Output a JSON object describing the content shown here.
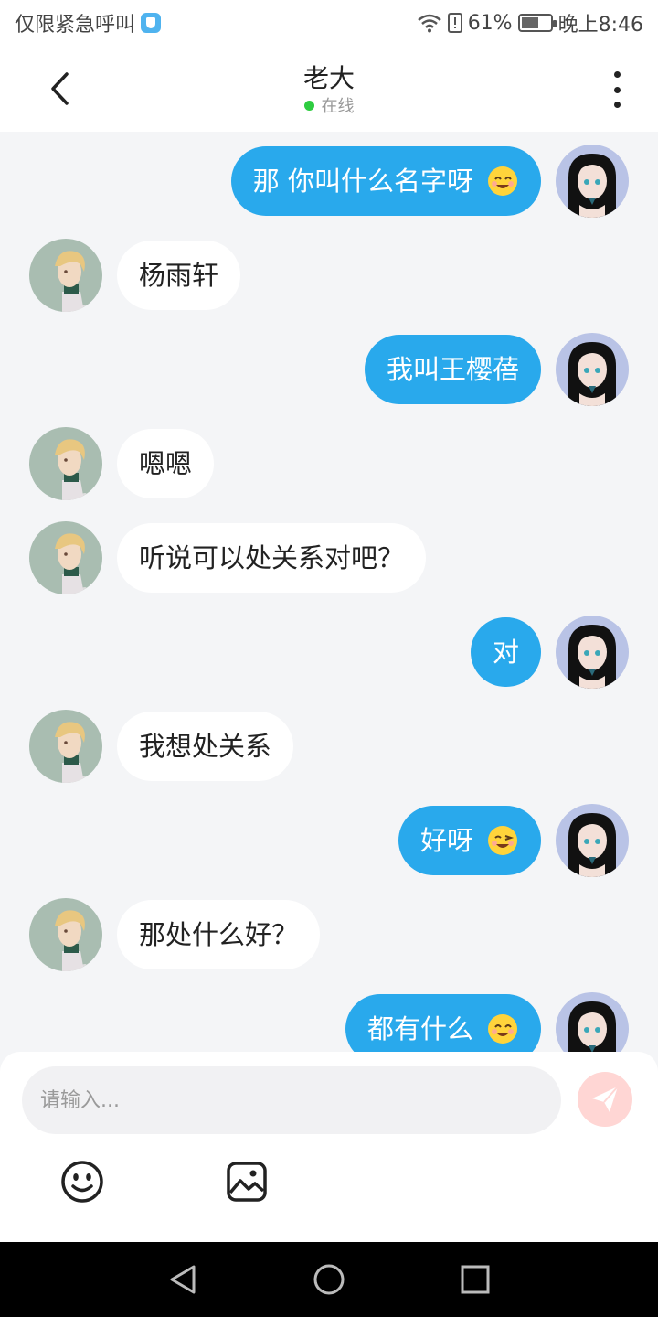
{
  "status_bar": {
    "left_text": "仅限紧急呼叫",
    "battery": "61%",
    "time": "晚上8:46",
    "icons": [
      "shield-icon",
      "wifi-icon",
      "sim-icon",
      "battery-icon"
    ]
  },
  "header": {
    "title": "老大",
    "status": "在线",
    "icons": [
      "back-arrow-icon",
      "more-vertical-icon"
    ]
  },
  "messages": [
    {
      "side": "out",
      "text": "那 你叫什么名字呀",
      "emoji": "smile"
    },
    {
      "side": "in",
      "text": "杨雨轩"
    },
    {
      "side": "out",
      "text": "我叫王樱蓓"
    },
    {
      "side": "in",
      "text": "嗯嗯"
    },
    {
      "side": "in",
      "text": "听说可以处关系对吧？"
    },
    {
      "side": "out",
      "text": "对"
    },
    {
      "side": "in",
      "text": "我想处关系"
    },
    {
      "side": "out",
      "text": "好呀",
      "emoji": "wink"
    },
    {
      "side": "in",
      "text": "那处什么好？"
    },
    {
      "side": "out",
      "text": "都有什么",
      "emoji": "smile"
    }
  ],
  "composer": {
    "placeholder": "请输入...",
    "icons": [
      "send-icon",
      "emoji-icon",
      "image-icon"
    ]
  },
  "navbar": {
    "icons": [
      "back-triangle-icon",
      "home-circle-icon",
      "recents-square-icon"
    ]
  },
  "colors": {
    "outgoing_bubble": "#29a9ec",
    "incoming_bubble": "#ffffff",
    "chat_background": "#f4f5f7",
    "online": "#2ecc40",
    "send_button": "#ffd6d4"
  }
}
